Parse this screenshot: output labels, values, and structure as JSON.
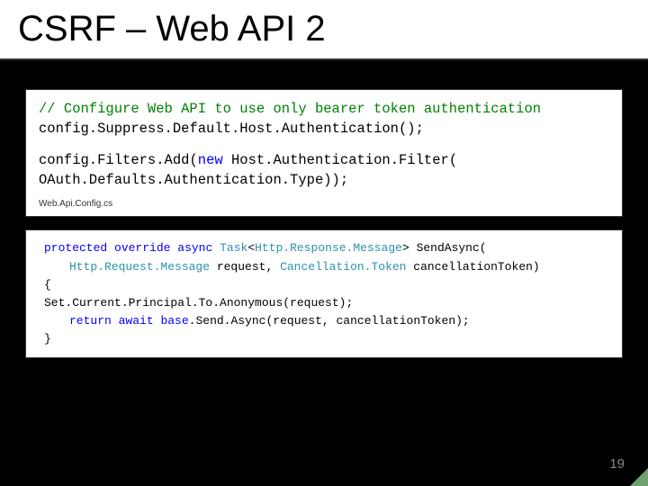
{
  "title": "CSRF – Web API 2",
  "code1": {
    "line1_comment": "// Configure Web API to use only bearer token authentication",
    "line2_plain_a": "config.",
    "line2_call": "Suppress.Default.Host.Authentication();",
    "line3_plain_a": "config.",
    "line3_mid": "Filters.",
    "line3_add": "Add(",
    "line3_new": "new",
    "line3_rest_a": " Host.Authentication.Filter(",
    "line4_indent": "  OAuth.Defaults.",
    "line4_member": "Authentication.Type));",
    "caption": "Web.Api.Config.cs"
  },
  "code2": {
    "kw_protected": "protected",
    "kw_override": "override",
    "kw_async": "async",
    "type_task": "Task",
    "lt": "<",
    "type_resp": "Http.Response.Message",
    "gt": ">",
    "method": " SendAsync(",
    "type_req": "Http.Request.Message",
    "param_req": " request",
    "comma": ", ",
    "type_ct": "Cancellation.Token",
    "param_ct": " cancellationToken)",
    "brace_open": "{",
    "body1": "    Set.Current.Principal.To.Anonymous(request);",
    "kw_return": "return",
    "kw_await": "await",
    "kw_base": "base",
    "body2_rest": ".Send.Async(request, cancellationToken);",
    "brace_close": "}"
  },
  "page_number": "19"
}
